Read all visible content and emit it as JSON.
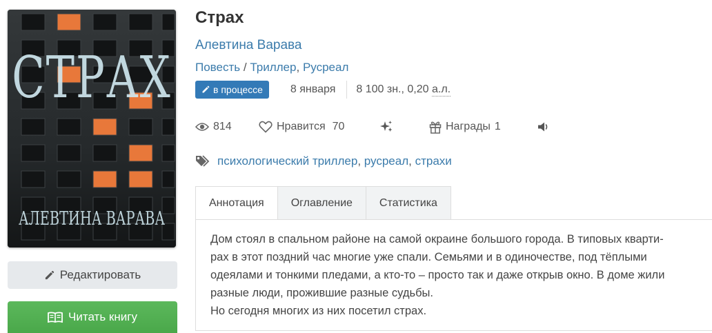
{
  "book": {
    "title": "Страх",
    "author": "Алевтина Варава",
    "genres": [
      "Повесть",
      "Триллер",
      "Русреал"
    ],
    "genre_separator": "/",
    "status": "в процессе",
    "date": "8 января",
    "size": "8 100 зн., 0,20",
    "size_unit": "а.л."
  },
  "cover": {
    "title_text": "СТРАХ",
    "author_text": "АЛЕВТИНА ВАРАВА"
  },
  "stats": {
    "views": "814",
    "likes_label": "Нравится",
    "likes": "70",
    "awards_label": "Награды",
    "awards": "1"
  },
  "tags": [
    "психологический триллер",
    "русреал",
    "страхи"
  ],
  "buttons": {
    "edit": "Редактировать",
    "read": "Читать книгу"
  },
  "tabs": [
    {
      "label": "Аннотация",
      "active": true
    },
    {
      "label": "Оглавление",
      "active": false
    },
    {
      "label": "Статистика",
      "active": false
    }
  ],
  "annotation": {
    "lines": [
      "Дом стоял в спальном районе на самой окраине большого города. В типовых кварти-",
      "рах в этот поздний час многие уже спали. Семьями и в одиночестве, под тёплыми",
      "одеялами и тонкими пледами, а кто-то – просто так и даже открыв окно. В доме жили",
      "разные люди, прожившие разные судьбы.",
      "Но сегодня многих из них посетил страх."
    ]
  },
  "colors": {
    "link": "#3b7bab",
    "badge": "#337ab7",
    "read_button": "#5cb85c",
    "edit_button": "#e6e9ec",
    "window_lit": "#e8783a"
  },
  "icons": [
    "pencil-icon",
    "book-open-icon",
    "eye-icon",
    "heart-icon",
    "sparkles-icon",
    "gift-icon",
    "speaker-icon",
    "tags-icon"
  ]
}
